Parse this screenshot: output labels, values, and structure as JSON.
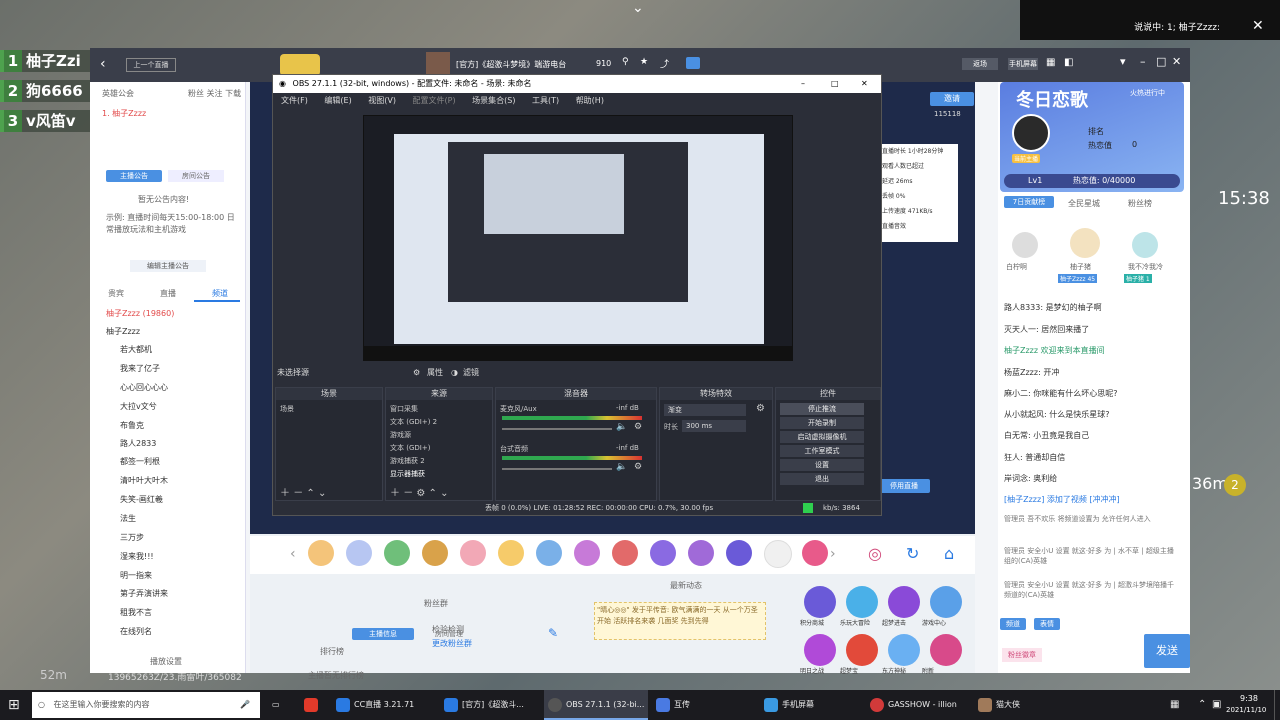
{
  "top_notice": "说说中: 1; 柚子Zzzz:",
  "game": {
    "scores": [
      {
        "rank": "1",
        "name": "柚子Zzi"
      },
      {
        "rank": "2",
        "name": "狗6666"
      },
      {
        "rank": "3",
        "name": "v风笛v"
      }
    ],
    "timer": "15:38",
    "distance": "36m",
    "badge_num": "2",
    "bottom_left": "52m",
    "bottom_text": "13965263Z/23.雨雷叶/365082"
  },
  "cc": {
    "back_label": "上一个直播",
    "room_title": "[官方]《超激斗梦境》端游电台",
    "room_id": "910",
    "titlebar_btns": [
      "返场",
      "手机屏幕"
    ],
    "left": {
      "header_a": "英雄公会",
      "header_b": "粉丝 关注 下载",
      "online_user": "1. 柚子Zzzz",
      "tabs": [
        "主播公告",
        "房间公告"
      ],
      "notice_placeholder": "暂无公告内容!",
      "notice_text": "示例: 直播时间每天15:00-18:00 日常播放玩法和主机游戏",
      "edit_notice_btn": "编辑主播公告",
      "subtabs": [
        "贵宾",
        "直播",
        "频道"
      ],
      "members": [
        "柚子Zzzz (19860)",
        "柚子Zzzz",
        "若大都机",
        "我来了亿子",
        "心心回心心心",
        "大拉v文兮",
        "布鲁克",
        "路人2833",
        "都签一利根",
        "清叶叶大叶木",
        "失笑-画红羲",
        "法生",
        "三万步",
        "湿来我!!!",
        "明一指来",
        "第子弄演讲来",
        "租我不言",
        "在线列名"
      ],
      "footer": "播放设置"
    },
    "center": {
      "invite_btn": "邀请",
      "invite_count": "115118",
      "stats": [
        "直播时长 1小时28分钟",
        "观看人数已超过",
        "延迟 26ms",
        "丢帧 0%",
        "上传速度 471KB/s",
        "直播音效"
      ],
      "tabs": [
        "主播信息",
        "房间管理"
      ],
      "ranking_label": "排行榜",
      "no_rank": "主播暂无排行榜",
      "fans_label": "粉丝群",
      "fans_sub": "检验检测",
      "fans_link": "更改粉丝群",
      "recent_label": "最新动态",
      "tip_text": "\"晴心◎◎\" 发于平传音: 欧气满满的一天 从一个万圣开始 活跃排名来袭 几面奖 先到先得",
      "stream_btn": "停用直播",
      "games": [
        "积分商城",
        "乐玩大冒险",
        "超梦进击",
        "游戏中心",
        "明日之战",
        "超梦宝",
        "东方神秘",
        "附新"
      ]
    },
    "right": {
      "card_title": "冬日恋歌",
      "card_status": "火热进行中",
      "rank_label": "排名",
      "heat_label": "热恋值",
      "heat_value": "0",
      "streamer_tag": "当前主播",
      "level": "Lv1",
      "heat_progress": "热恋值: 0/40000",
      "tabs": [
        "7日贡献榜",
        "全民星城",
        "粉丝榜"
      ],
      "avatar_labels": [
        "白柠啊",
        "柚子猪",
        "我不冷我冷"
      ],
      "rank_badges": [
        "柚子Zzzz 45",
        "柚子猪 1"
      ],
      "messages": [
        "路人8333: 是梦幻的柚子啊",
        "灭天人一: 居然回来播了",
        "柚子Zzzz 欢迎来到本直播间",
        "杨蓝Zzzz: 开冲",
        "麻小二: 你咪能有什么坏心思呢?",
        "从小就起风: 什么是快乐星球?",
        "白无常: 小丑竟是我自己",
        "狂人: 普通却自信",
        "岸词念: 奥利给",
        "[柚子Zzzz] 添加了视频 [冲冲冲]",
        "管理员 吾不欢乐 将频道设置为 允许任何人进入",
        "管理员 安全小U 设置 就这·好多 为 | 水不草 | 超级主播组的(CA)英雄",
        "管理员 安全小U 设置 就这·好多 为 | 超激斗梦境陪播千 频道的(CA)英雄"
      ],
      "toolbar_btns": [
        "频道",
        "表情"
      ],
      "gift_btn": "粉丝徽章",
      "send_btn": "发送"
    }
  },
  "obs": {
    "title": "OBS 27.1.1 (32-bit, windows) - 配置文件: 未命名 - 场景: 未命名",
    "menu": [
      "文件(F)",
      "编辑(E)",
      "视图(V)",
      "配置文件(P)",
      "场景集合(S)",
      "工具(T)",
      "帮助(H)"
    ],
    "no_source": "未选择源",
    "props_btn": "属性",
    "filter_btn": "滤镜",
    "docks": {
      "scenes": "场景",
      "sources": "来源",
      "mixer": "混音器",
      "transitions": "转场特效",
      "controls": "控件"
    },
    "scene_item": "场景",
    "source_items": [
      "窗口采集",
      "文本 (GDI+) 2",
      "游戏源",
      "文本 (GDI+)",
      "游戏捕获 2",
      "显示器捕获"
    ],
    "mixer_tracks": [
      {
        "name": "麦克风/Aux",
        "db": "-inf dB"
      },
      {
        "name": "台式音频",
        "db": "-inf dB"
      }
    ],
    "transition": "渐变",
    "duration_label": "时长",
    "duration_value": "300 ms",
    "control_btns": [
      "停止推流",
      "开始录制",
      "启动虚拟摄像机",
      "工作室模式",
      "设置",
      "退出"
    ],
    "status": "丢帧 0 (0.0%)   LIVE: 01:28:52   REC: 00:00:00   CPU: 0.7%, 30.00 fps",
    "kbps": "kb/s: 3864"
  },
  "taskbar": {
    "search_placeholder": "在这里输入你要搜索的内容",
    "items": [
      "CC直播 3.21.71",
      "[官方]《超激斗...",
      "OBS 27.1.1 (32-bi...",
      "互传",
      "手机屏幕",
      "GASSHOW - illion",
      "猫大侠"
    ],
    "time": "9:38",
    "date": "2021/11/10"
  }
}
